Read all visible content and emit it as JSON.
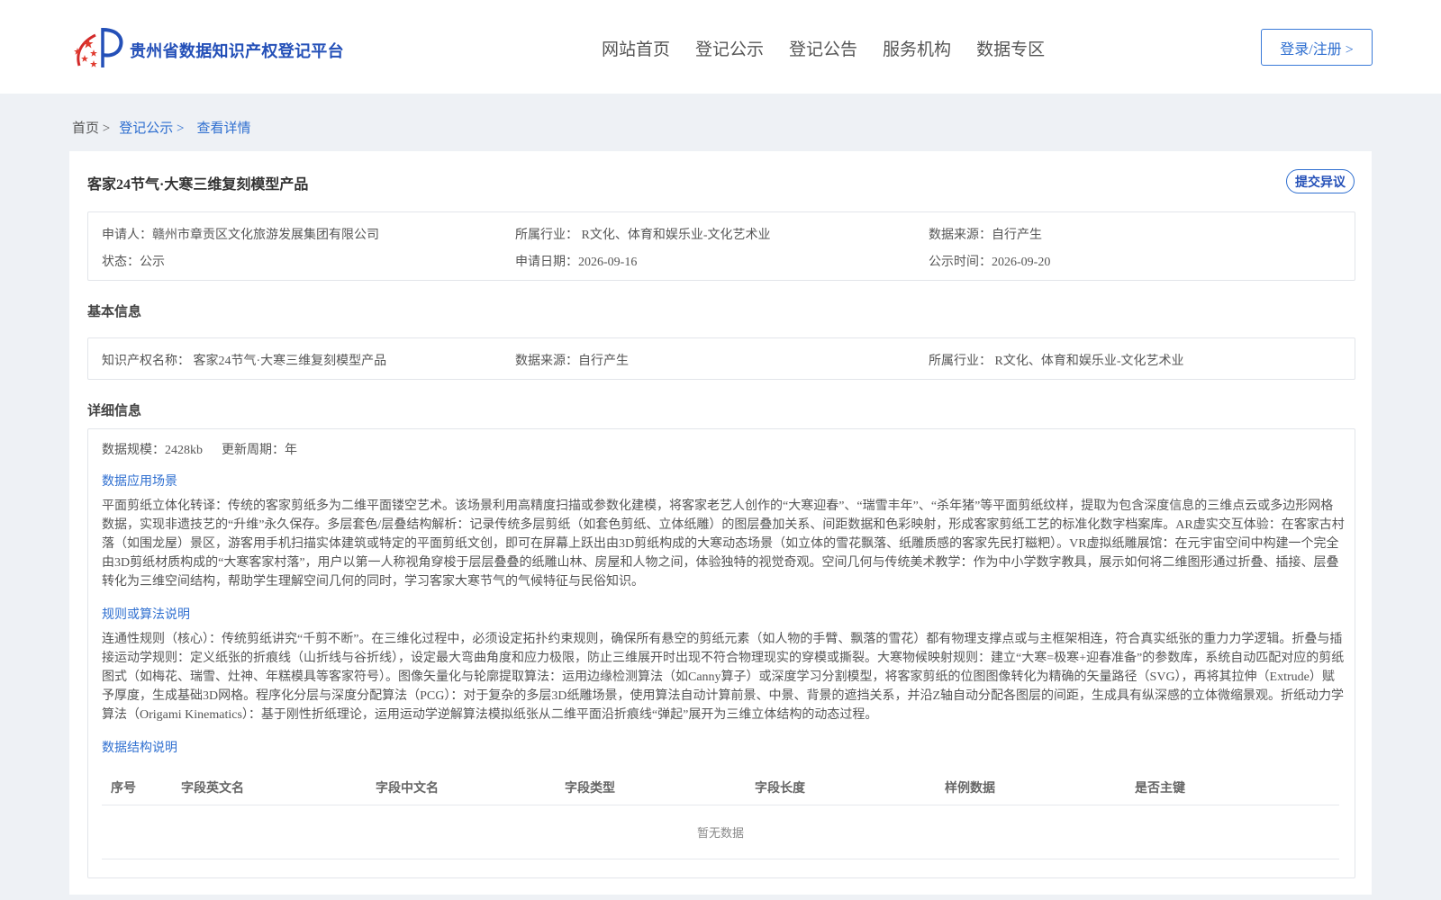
{
  "header": {
    "site_title": "贵州省数据知识产权登记平台",
    "nav": [
      "网站首页",
      "登记公示",
      "登记公告",
      "服务机构",
      "数据专区"
    ],
    "login_label": "登录/注册 >"
  },
  "breadcrumb": {
    "home": "首页 >",
    "parent": "登记公示 >",
    "current": "查看详情"
  },
  "record": {
    "title": "客家24节气·大寒三维复刻模型产品",
    "objection_label": "提交异议",
    "applicant": "申请人：赣州市章贡区文化旅游发展集团有限公司",
    "industry": "所属行业： R文化、体育和娱乐业-文化艺术业",
    "source": "数据来源：自行产生",
    "status": "状态：公示",
    "apply_date": "申请日期：2026-09-16",
    "publish_date": "公示时间：2026-09-20"
  },
  "basic": {
    "section_title": "基本信息",
    "ip_name": "知识产权名称： 客家24节气·大寒三维复刻模型产品",
    "source": "数据来源：自行产生",
    "industry": "所属行业： R文化、体育和娱乐业-文化艺术业"
  },
  "detail": {
    "section_title": "详细信息",
    "scale": "数据规模：2428kb",
    "period": "更新周期：年",
    "scenario_title": "数据应用场景",
    "scenario_text": "平面剪纸立体化转译：传统的客家剪纸多为二维平面镂空艺术。该场景利用高精度扫描或参数化建模，将客家老艺人创作的“大寒迎春”、“瑞雪丰年”、“杀年猪”等平面剪纸纹样，提取为包含深度信息的三维点云或多边形网格数据，实现非遗技艺的“升维”永久保存。多层套色/层叠结构解析：记录传统多层剪纸（如套色剪纸、立体纸雕）的图层叠加关系、间距数据和色彩映射，形成客家剪纸工艺的标准化数字档案库。AR虚实交互体验：在客家古村落（如围龙屋）景区，游客用手机扫描实体建筑或特定的平面剪纸文创，即可在屏幕上跃出由3D剪纸构成的大寒动态场景（如立体的雪花飘落、纸雕质感的客家先民打糍粑）。VR虚拟纸雕展馆：在元宇宙空间中构建一个完全由3D剪纸材质构成的“大寒客家村落”，用户以第一人称视角穿梭于层层叠叠的纸雕山林、房屋和人物之间，体验独特的视觉奇观。空间几何与传统美术教学：作为中小学数字教具，展示如何将二维图形通过折叠、插接、层叠转化为三维空间结构，帮助学生理解空间几何的同时，学习客家大寒节气的气候特征与民俗知识。",
    "algo_title": "规则或算法说明",
    "algo_text": "连通性规则（核心）：传统剪纸讲究“千剪不断”。在三维化过程中，必须设定拓扑约束规则，确保所有悬空的剪纸元素（如人物的手臂、飘落的雪花）都有物理支撑点或与主框架相连，符合真实纸张的重力力学逻辑。折叠与插接运动学规则：定义纸张的折痕线（山折线与谷折线），设定最大弯曲角度和应力极限，防止三维展开时出现不符合物理现实的穿模或撕裂。大寒物候映射规则：建立“大寒=极寒+迎春准备”的参数库，系统自动匹配对应的剪纸图式（如梅花、瑞雪、灶神、年糕模具等客家符号）。图像矢量化与轮廓提取算法：运用边缘检测算法（如Canny算子）或深度学习分割模型，将客家剪纸的位图图像转化为精确的矢量路径（SVG），再将其拉伸（Extrude）赋予厚度，生成基础3D网格。程序化分层与深度分配算法（PCG）：对于复杂的多层3D纸雕场景，使用算法自动计算前景、中景、背景的遮挡关系，并沿Z轴自动分配各图层的间距，生成具有纵深感的立体微缩景观。折纸动力学算法（Origami Kinematics）：基于刚性折纸理论，运用运动学逆解算法模拟纸张从二维平面沿折痕线“弹起”展开为三维立体结构的动态过程。",
    "structure_title": "数据结构说明",
    "table_headers": [
      "序号",
      "字段英文名",
      "字段中文名",
      "字段类型",
      "字段长度",
      "样例数据",
      "是否主键"
    ],
    "empty_text": "暂无数据"
  }
}
